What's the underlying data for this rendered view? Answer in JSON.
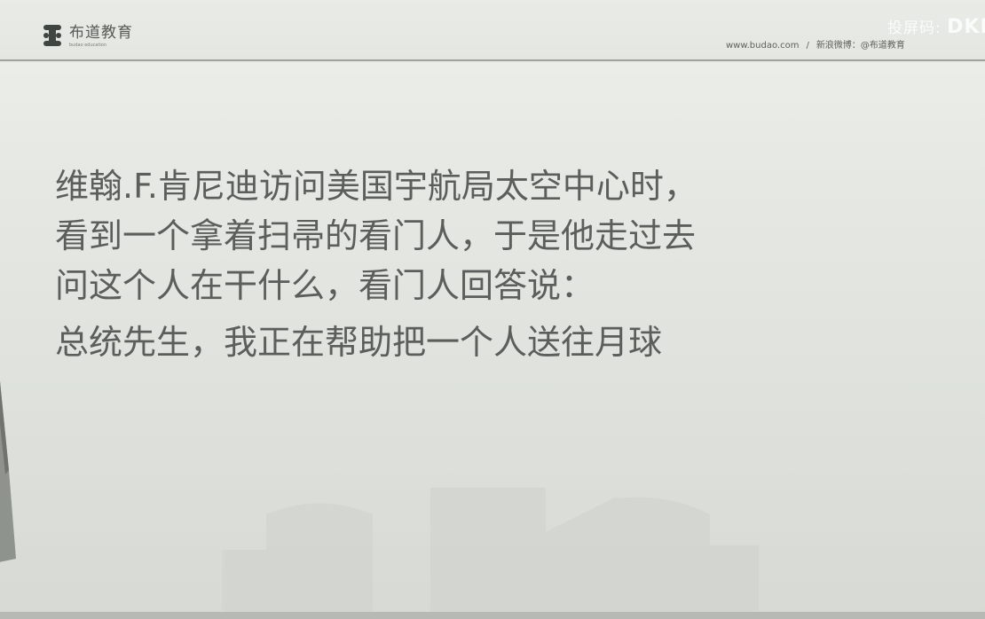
{
  "header": {
    "logo_name": "布道教育",
    "logo_sub": "budao education",
    "website": "www.budao.com",
    "separator": "/",
    "weibo": "新浪微博：@布道教育"
  },
  "watermark": {
    "text": "投屏码: ",
    "code": "DKF"
  },
  "slide": {
    "lines": [
      "维翰.F.肯尼迪访问美国宇航局太空中心时，",
      "看到一个拿着扫帚的看门人，于是他走过去",
      "问这个人在干什么，看门人回答说："
    ],
    "quote": "总统先生，我正在帮助把一个人送往月球"
  },
  "colors": {
    "text": "#5b5f5b",
    "header_line": "#9ea39c",
    "background": "#e6e9e4"
  }
}
